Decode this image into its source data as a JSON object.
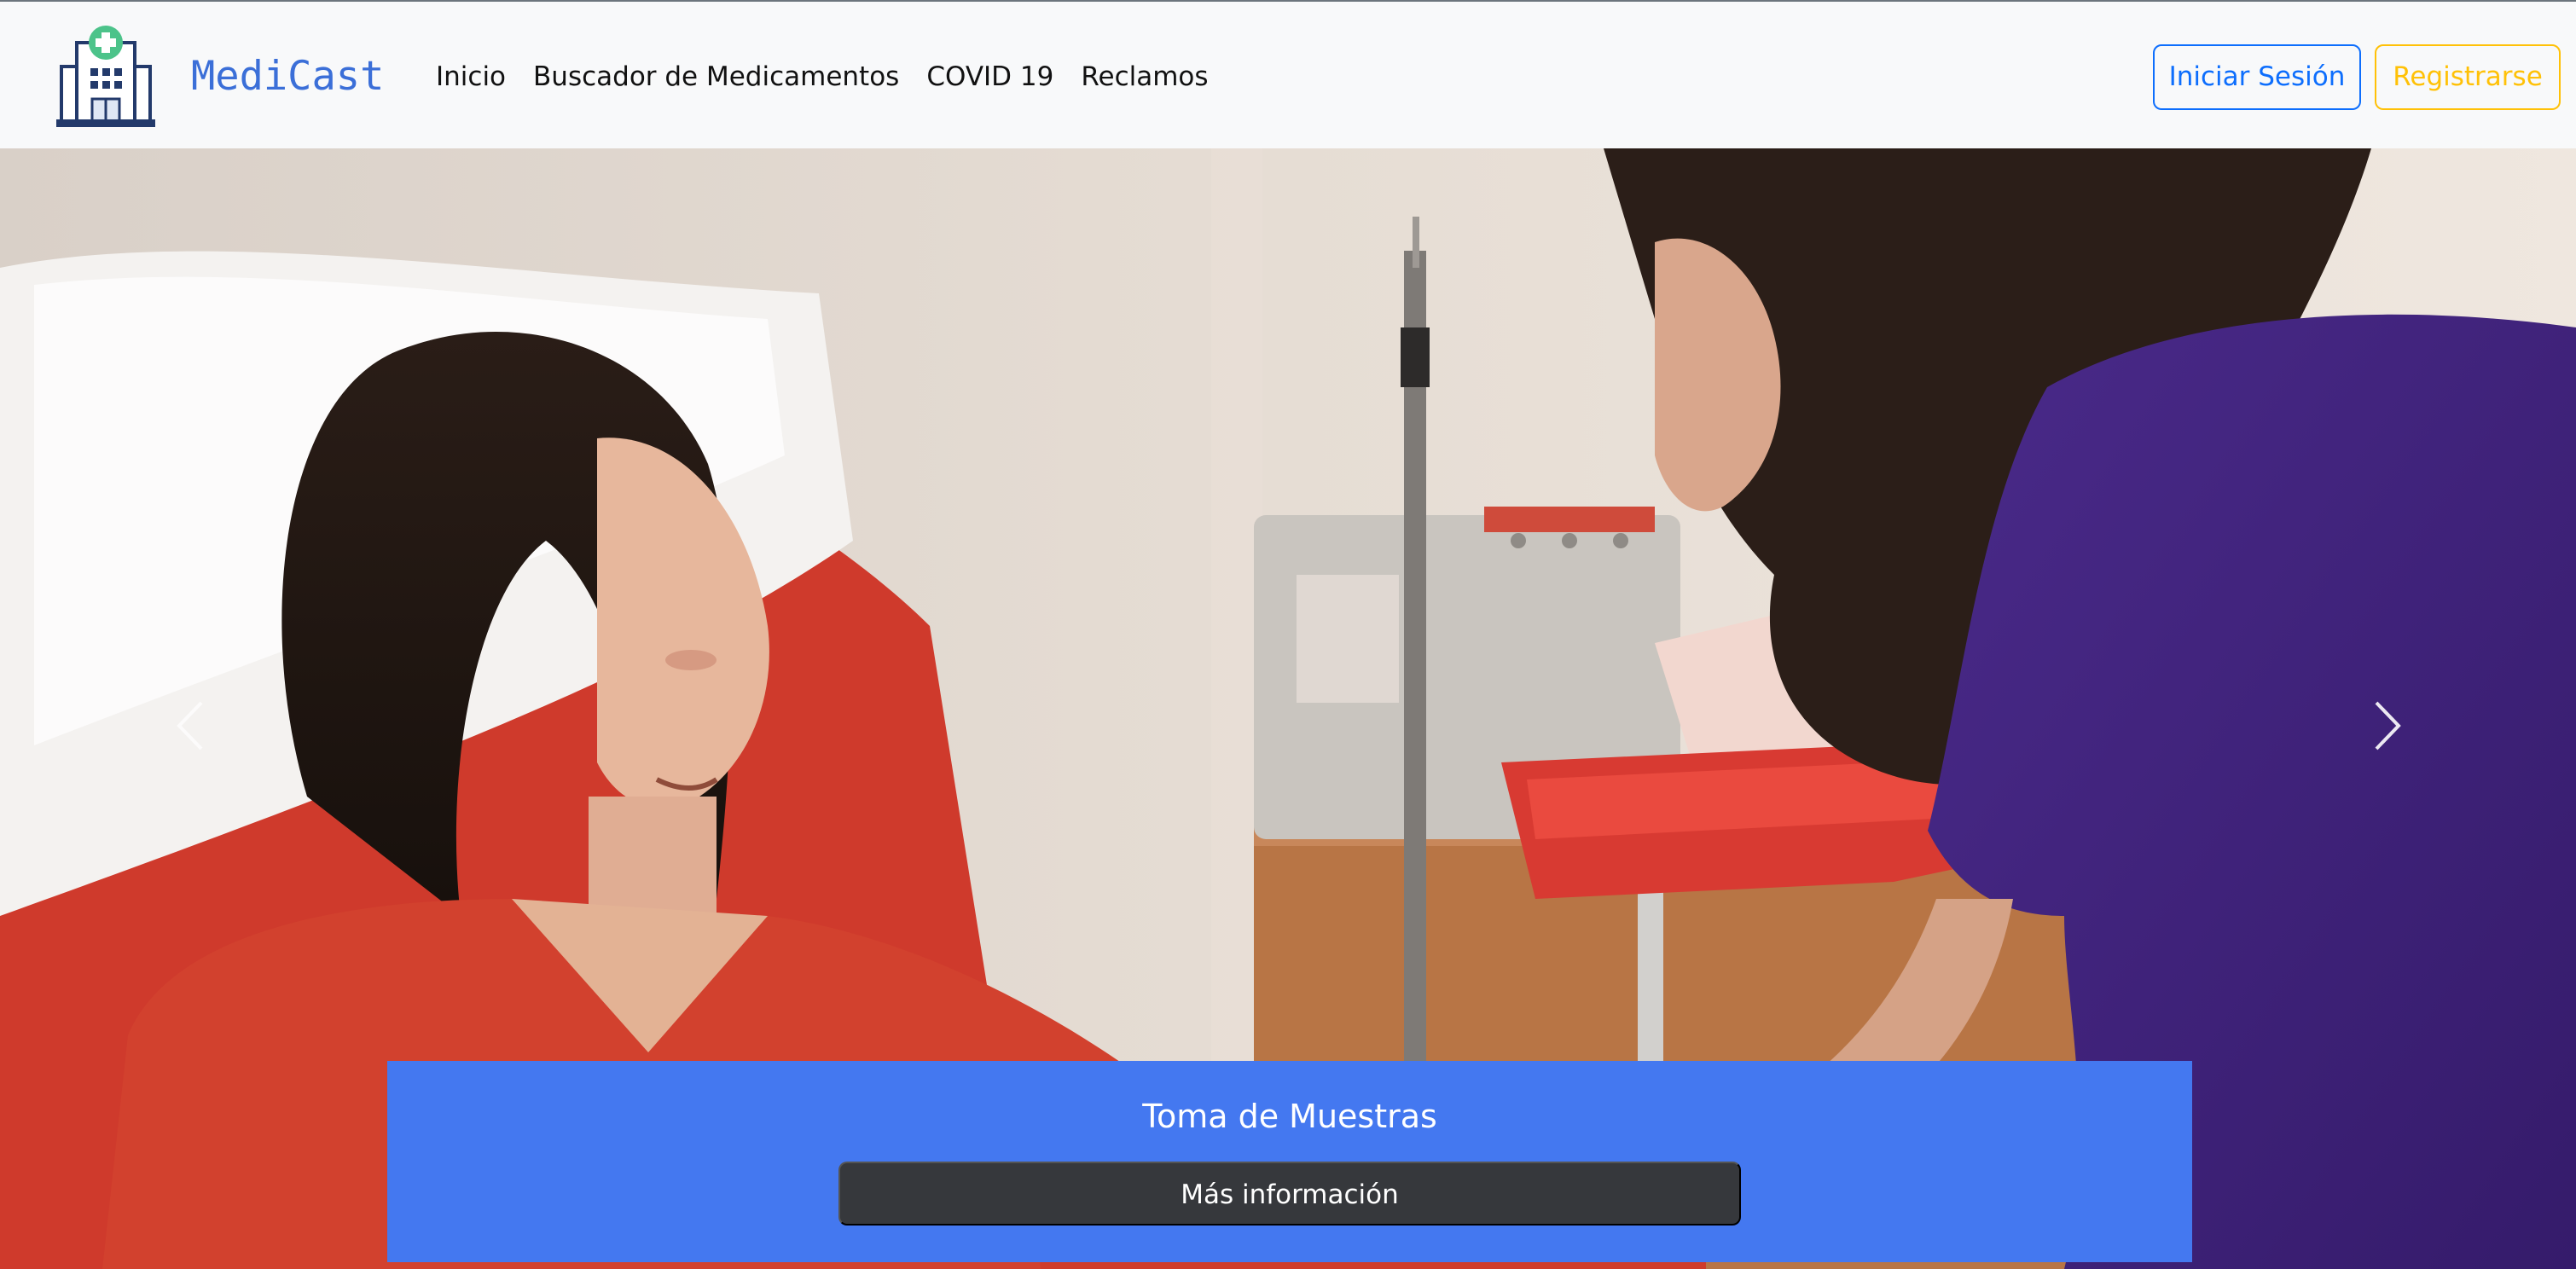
{
  "brand": {
    "name": "MediCast"
  },
  "nav": {
    "items": [
      {
        "label": "Inicio"
      },
      {
        "label": "Buscador de Medicamentos"
      },
      {
        "label": "COVID 19"
      },
      {
        "label": "Reclamos"
      }
    ]
  },
  "auth": {
    "login_label": "Iniciar Sesión",
    "register_label": "Registrarse"
  },
  "carousel": {
    "slide": {
      "title": "Toma de Muestras",
      "button_label": "Más información"
    }
  },
  "colors": {
    "brand": "#3b6fd8",
    "login": "#0d6efd",
    "register": "#ffc107",
    "caption_bg": "#4478f0",
    "caption_button": "#36383c"
  },
  "icons": {
    "logo": "hospital-logo-icon",
    "prev": "chevron-left-icon",
    "next": "chevron-right-icon"
  }
}
